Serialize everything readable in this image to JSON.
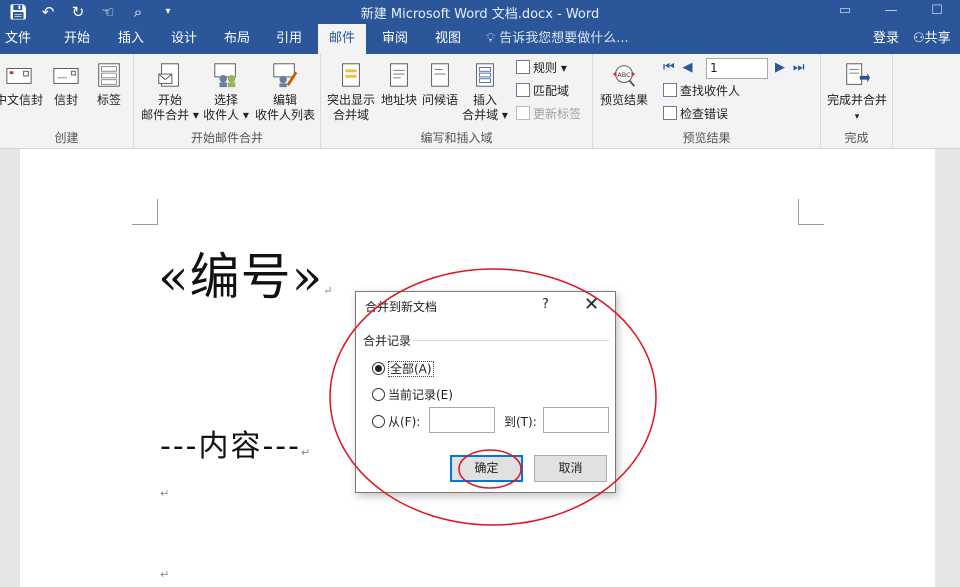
{
  "window": {
    "title": "新建 Microsoft Word 文档.docx - Word",
    "controls": [
      "restore",
      "minimize",
      "maximize",
      "close"
    ]
  },
  "quick_access": [
    "save-icon",
    "undo-icon",
    "redo-icon",
    "touch-mode-icon",
    "print-preview-icon",
    "customize-icon"
  ],
  "tabs": [
    {
      "label": "文件"
    },
    {
      "label": "开始"
    },
    {
      "label": "插入"
    },
    {
      "label": "设计"
    },
    {
      "label": "布局"
    },
    {
      "label": "引用"
    },
    {
      "label": "邮件",
      "active": true
    },
    {
      "label": "审阅"
    },
    {
      "label": "视图"
    }
  ],
  "tell_me": "告诉我您想要做什么...",
  "account": {
    "login": "登录",
    "share": "共享"
  },
  "ribbon": {
    "create": {
      "label": "创建",
      "buttons": [
        "中文信封",
        "信封",
        "标签"
      ]
    },
    "start_merge": {
      "label": "开始邮件合并",
      "buttons": [
        {
          "line1": "开始",
          "line2": "邮件合并 ▾"
        },
        {
          "line1": "选择",
          "line2": "收件人 ▾"
        },
        {
          "line1": "编辑",
          "line2": "收件人列表"
        }
      ]
    },
    "write_insert": {
      "label": "编写和插入域",
      "buttons": [
        {
          "line1": "突出显示",
          "line2": "合并域"
        },
        {
          "line1": "地址块",
          "line2": ""
        },
        {
          "line1": "问候语",
          "line2": ""
        },
        {
          "line1": "插入",
          "line2": "合并域 ▾"
        }
      ],
      "small": [
        "规则 ▾",
        "匹配域",
        "更新标签"
      ]
    },
    "preview": {
      "label": "预览结果",
      "preview_button": "预览结果",
      "record": "1",
      "small": [
        "查找收件人",
        "检查错误"
      ]
    },
    "finish": {
      "label": "完成",
      "button": "完成并合并",
      "arrow": "▾"
    }
  },
  "document": {
    "heading": "«编号»",
    "body": "---内容---",
    "para_mark": "↵"
  },
  "dialog": {
    "title": "合并到新文档",
    "help": "?",
    "close": "✕",
    "section": "合并记录",
    "options": [
      {
        "label": "全部(A)",
        "checked": true
      },
      {
        "label": "当前记录(E)",
        "checked": false
      },
      {
        "label": "从(F):",
        "checked": false
      }
    ],
    "from_value": "",
    "to_label": "到(T):",
    "to_value": "",
    "ok": "确定",
    "cancel": "取消"
  },
  "annotation_color": "#e0141e"
}
